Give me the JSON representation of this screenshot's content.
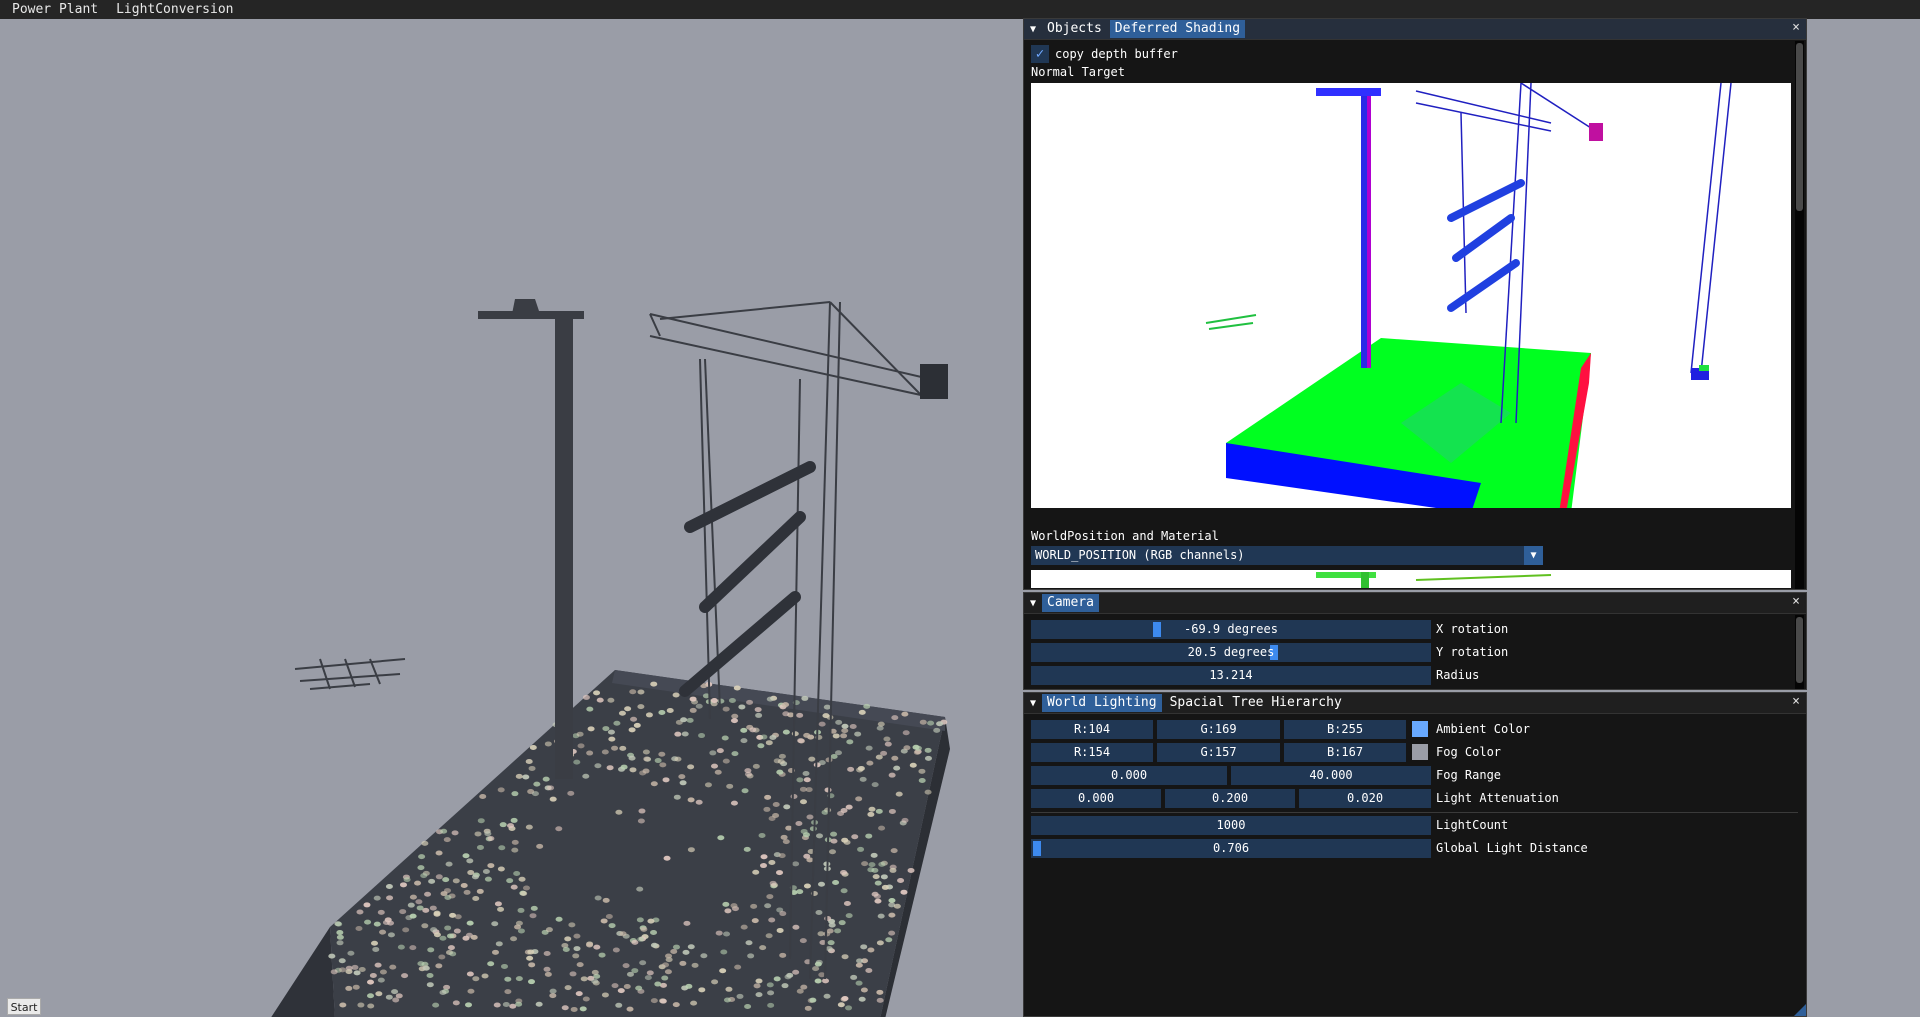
{
  "menu": [
    "Power Plant",
    "LightConversion"
  ],
  "start_button": "Start",
  "deferred_panel": {
    "tabs": [
      "Objects",
      "Deferred Shading"
    ],
    "active_tab": 1,
    "copy_depth_label": "copy depth buffer",
    "copy_depth_checked": true,
    "normal_target_label": "Normal Target",
    "worldpos_label": "WorldPosition and Material",
    "dropdown_value": "WORLD_POSITION (RGB channels)",
    "close": "×"
  },
  "camera_panel": {
    "tabs": [
      "Camera"
    ],
    "close": "×",
    "x_rotation": {
      "value": "-69.9 degrees",
      "label": "X rotation",
      "fraction": 0.31
    },
    "y_rotation": {
      "value": "20.5 degrees",
      "label": "Y rotation",
      "fraction": 0.61
    },
    "radius": {
      "value": "13.214",
      "label": "Radius"
    }
  },
  "lighting_panel": {
    "tabs": [
      "World Lighting",
      "Spacial Tree Hierarchy"
    ],
    "close": "×",
    "ambient": {
      "r": "R:104",
      "g": "G:169",
      "b": "B:255",
      "label": "Ambient Color",
      "color": "#68a9ff"
    },
    "fog_color": {
      "r": "R:154",
      "g": "G:157",
      "b": "B:167",
      "label": "Fog Color",
      "color": "#9a9da7"
    },
    "fog_range": {
      "min": "0.000",
      "max": "40.000",
      "label": "Fog Range"
    },
    "attenuation": {
      "a": "0.000",
      "b": "0.200",
      "c": "0.020",
      "label": "Light Attenuation"
    },
    "light_count": {
      "value": "1000",
      "label": "LightCount"
    },
    "light_distance": {
      "value": "0.706",
      "label": "Global Light Distance",
      "fraction": 0.0
    }
  },
  "colors": {
    "panel_bg": "#151515",
    "field_bg": "#203754",
    "accent": "#3d8aef",
    "viewport_bg": "#9a9da7"
  }
}
